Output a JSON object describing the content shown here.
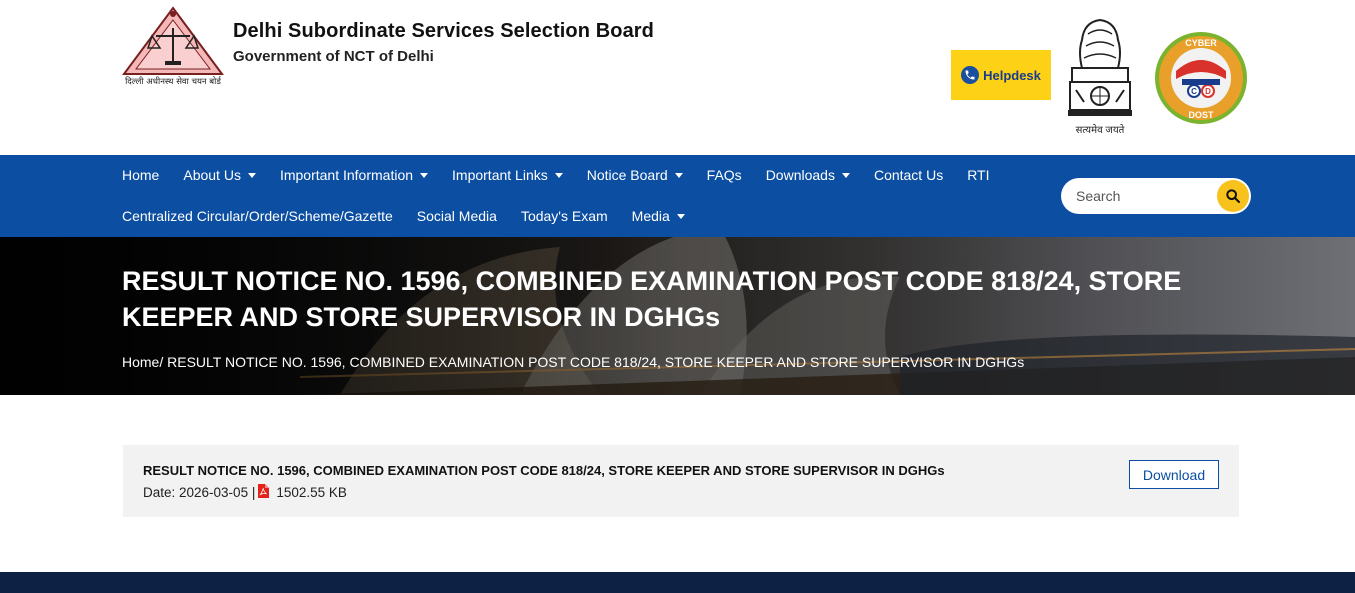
{
  "header": {
    "org_title": "Delhi Subordinate Services Selection Board",
    "org_subtitle": "Government of NCT of Delhi",
    "logo_caption": "दिल्ली अधीनस्थ सेवा चयन बोर्ड",
    "helpdesk_label": "Helpdesk",
    "emblem_caption": "सत्यमेव जयते",
    "cyber_badge": {
      "top": "CYBER",
      "bottom": "DOST",
      "letters": [
        "C",
        "D"
      ]
    }
  },
  "nav": {
    "row1": [
      {
        "label": "Home",
        "dropdown": false
      },
      {
        "label": "About Us",
        "dropdown": true
      },
      {
        "label": "Important Information",
        "dropdown": true
      },
      {
        "label": "Important Links",
        "dropdown": true
      },
      {
        "label": "Notice Board",
        "dropdown": true
      },
      {
        "label": "FAQs",
        "dropdown": false
      },
      {
        "label": "Downloads",
        "dropdown": true
      },
      {
        "label": "Contact Us",
        "dropdown": false
      },
      {
        "label": "RTI",
        "dropdown": false
      }
    ],
    "row2": [
      {
        "label": "Centralized Circular/Order/Scheme/Gazette",
        "dropdown": false
      },
      {
        "label": "Social Media",
        "dropdown": false
      },
      {
        "label": "Today's Exam",
        "dropdown": false
      },
      {
        "label": "Media",
        "dropdown": true
      }
    ],
    "search_placeholder": "Search"
  },
  "banner": {
    "title": "RESULT NOTICE NO. 1596, COMBINED EXAMINATION POST CODE 818/24, STORE KEEPER AND STORE SUPERVISOR IN DGHGs",
    "breadcrumb_home": "Home/",
    "breadcrumb_current": " RESULT NOTICE NO. 1596, COMBINED EXAMINATION POST CODE 818/24, STORE KEEPER AND STORE SUPERVISOR IN DGHGs"
  },
  "document": {
    "title": "RESULT NOTICE NO. 1596, COMBINED EXAMINATION POST CODE 818/24, STORE KEEPER AND STORE SUPERVISOR IN DGHGs",
    "date_text": "Date: 2026-03-05 |",
    "size": "1502.55 KB",
    "download_label": "Download"
  },
  "colors": {
    "nav_bg": "#0b4ea2",
    "helpdesk_bg": "#fcd116",
    "search_button": "#f7c21b",
    "footer_bg": "#0d2144",
    "content_bg": "#f2f2f2"
  },
  "icons": {
    "logo": "dsssb-scales-logo-icon",
    "emblem": "national-emblem-icon",
    "helpdesk": "phone-icon",
    "search": "search-icon",
    "pdf": "pdf-file-icon",
    "dropdown": "chevron-down-icon"
  }
}
